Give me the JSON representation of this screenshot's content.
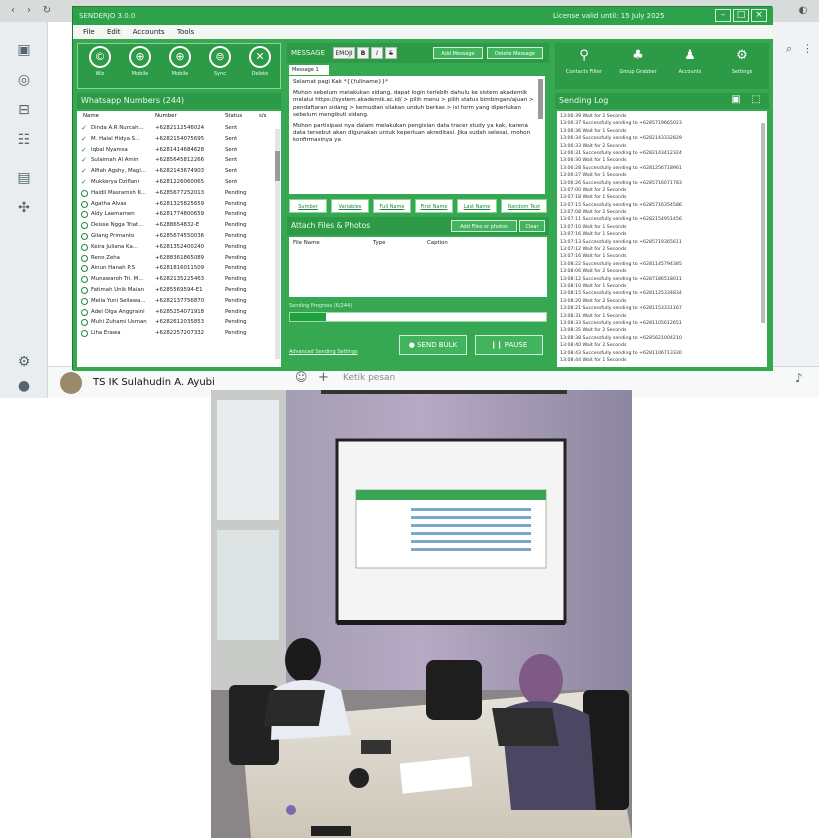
{
  "window": {
    "title": "SENDERJO 3.0.0",
    "license": "License valid until: 15 July 2025",
    "menu": [
      "File",
      "Edit",
      "Accounts",
      "Tools"
    ],
    "controls": [
      "–",
      "□",
      "×"
    ]
  },
  "whatsapp": {
    "contact": "TS IK Sulahudin A. Ayubi",
    "input_placeholder": "Ketik pesan"
  },
  "toolbar_left": [
    {
      "label": "Wiz",
      "icon": "©"
    },
    {
      "label": "Mobile",
      "icon": "⊕"
    },
    {
      "label": "Mobile",
      "icon": "⊕"
    },
    {
      "label": "Sync",
      "icon": "⊜"
    },
    {
      "label": "Delete",
      "icon": "✕"
    }
  ],
  "numbers": {
    "title": "Whatsapp Numbers (244)",
    "columns": [
      "Name",
      "Number",
      "Status",
      "s/s"
    ],
    "rows": [
      {
        "name": "Dinda A.R Nurcah...",
        "number": "+6282112546024",
        "status": "Sent",
        "state": "sent"
      },
      {
        "name": "M. Halal Hidya S...",
        "number": "+6282154075695",
        "status": "Sent",
        "state": "sent"
      },
      {
        "name": "Iqbal Nyamsa",
        "number": "+6281414684628",
        "status": "Sent",
        "state": "sent"
      },
      {
        "name": "Sulaimah Al Amin",
        "number": "+6285645812266",
        "status": "Sent",
        "state": "sent"
      },
      {
        "name": "Alfiah Agshy, Magi...",
        "number": "+6282143674903",
        "status": "Sent",
        "state": "sent"
      },
      {
        "name": "Mukkerya Dziflani",
        "number": "+6281226060065",
        "status": "Sent",
        "state": "sent"
      },
      {
        "name": "Haidil Masramsh K...",
        "number": "+6285677252013",
        "status": "Pending",
        "state": "pending"
      },
      {
        "name": "Agatha Alvas",
        "number": "+6281325825659",
        "status": "Pending",
        "state": "pending"
      },
      {
        "name": "Aldy Laemamen",
        "number": "+6281774800659",
        "status": "Pending",
        "state": "pending"
      },
      {
        "name": "Deisse Ngga Triat...",
        "number": "+6288654832-E",
        "status": "Pending",
        "state": "pending"
      },
      {
        "name": "Gilang Primanto",
        "number": "+6285674550036",
        "status": "Pending",
        "state": "pending"
      },
      {
        "name": "Keira Juliana Ka...",
        "number": "+6281352400240",
        "status": "Pending",
        "state": "pending"
      },
      {
        "name": "Reno Zeha",
        "number": "+6288361865089",
        "status": "Pending",
        "state": "pending"
      },
      {
        "name": "Ainun Hanah P.S",
        "number": "+6281816011509",
        "status": "Pending",
        "state": "pending"
      },
      {
        "name": "Munawaroh Tri. M...",
        "number": "+6282135225463",
        "status": "Pending",
        "state": "pending"
      },
      {
        "name": "Fatimah Unik Maian",
        "number": "+6285569594-E1",
        "status": "Pending",
        "state": "pending"
      },
      {
        "name": "Melia Yuni Sellawa...",
        "number": "+6282137756870",
        "status": "Pending",
        "state": "pending"
      },
      {
        "name": "Adel Olga Anggraini",
        "number": "+6285254071918",
        "status": "Pending",
        "state": "pending"
      },
      {
        "name": "Muhi Zuhami Usman",
        "number": "+6282612035853",
        "status": "Pending",
        "state": "pending"
      },
      {
        "name": "Liha Erawa",
        "number": "+6282257207332",
        "status": "Pending",
        "state": "pending"
      }
    ]
  },
  "message": {
    "title": "MESSAGE",
    "format_buttons": [
      "EMOJI",
      "B",
      "I",
      "S"
    ],
    "add_message": "Add Message",
    "delete_message": "Delete Message",
    "tab": "Message 1",
    "paragraphs": [
      "Selamat pagi Kak *{{fullname}}*",
      "Mohon sebelum melakukan sidang, dapat login terlebih dahulu ke sistem akademik melalui https://system.akademik.ac.id/ > pilih menu > pilih status bimbingan/ajuan > pendaftaran sidang > kemudian silakan unduh berkas > isi form yang diperlukan sebelum mengikuti sidang.",
      "Mohon partisipasi nya dalam melakukan pengisian data tracer study ya kak, karena data tersebut akan digunakan untuk keperluan akreditasi. Jika sudah selesai, mohon konfirmasinya ya"
    ],
    "variables": [
      "Sumber",
      "Variables",
      "Full Name",
      "First Name",
      "Last Name",
      "Random Text"
    ]
  },
  "attach": {
    "title": "Attach Files & Photos",
    "add_button": "Add Files or photos",
    "clear_button": "Clear",
    "columns": [
      "File Name",
      "Type",
      "Caption"
    ]
  },
  "progress": {
    "label": "Sending Progress (6/244)",
    "fraction": 0.14
  },
  "actions": {
    "advanced": "Advanced Sending Settings",
    "send": "SEND BULK",
    "pause": "PAUSE"
  },
  "toolbar_right": [
    {
      "label": "Contacts Filter",
      "icon": "⚲"
    },
    {
      "label": "Group Grabber",
      "icon": "♣"
    },
    {
      "label": "Accounts",
      "icon": "♟"
    },
    {
      "label": "Settings",
      "icon": "⚙"
    }
  ],
  "log": {
    "title": "Sending Log",
    "icons": [
      "▣",
      "⬚"
    ],
    "lines": [
      "13:06:39 Wait for 2 Seconds",
      "13:06:37 Successfully sending to +6285719665023",
      "13:06:36 Wait for 1 Seconds",
      "13:06:34 Successfully sending to +6282143332829",
      "13:06:33 Wait for 2 Seconds",
      "13:06:31 Successfully sending to +6282143412324",
      "13:06:30 Wait for 1 Seconds",
      "13:06:28 Successfully sending to +6281256718961",
      "13:06:27 Wait for 1 Seconds",
      "13:06:26 Successfully sending to +6285716071783",
      "13:07:00 Wait for 2 Seconds",
      "13:07:18 Wait for 1 Seconds",
      "13:07:15 Successfully sending to +6285716354586",
      "13:07:08 Wait for 2 Seconds",
      "13:07:11 Successfully sending to +6282154951456",
      "13:07:10 Wait for 1 Seconds",
      "13:07:16 Wait for 1 Seconds",
      "13:07:13 Successfully sending to +6285719365611",
      "13:07:12 Wait for 2 Seconds",
      "13:07:16 Wait for 1 Seconds",
      "13:08:22 Successfully sending to +6281145794385",
      "13:08:06 Wait for 2 Seconds",
      "13:08:12 Successfully sending to +6287186518011",
      "13:08:10 Wait for 1 Seconds",
      "13:08:15 Successfully sending to +6281125334834",
      "13:08:20 Wait for 2 Seconds",
      "13:08:21 Successfully sending to +6281153331167",
      "13:08:31 Wait for 1 Seconds",
      "13:08:33 Successfully sending to +6281105612651",
      "13:08:35 Wait for 2 Seconds",
      "13:08:38 Successfully sending to +6285621004210",
      "13:08:40 Wait for 2 Seconds",
      "13:08:43 Successfully sending to +6281106713330",
      "13:08:44 Wait for 1 Seconds"
    ]
  },
  "colors": {
    "app_green": "#36a852",
    "header_green": "#2d9a47",
    "progress_green": "#1fa23d"
  }
}
